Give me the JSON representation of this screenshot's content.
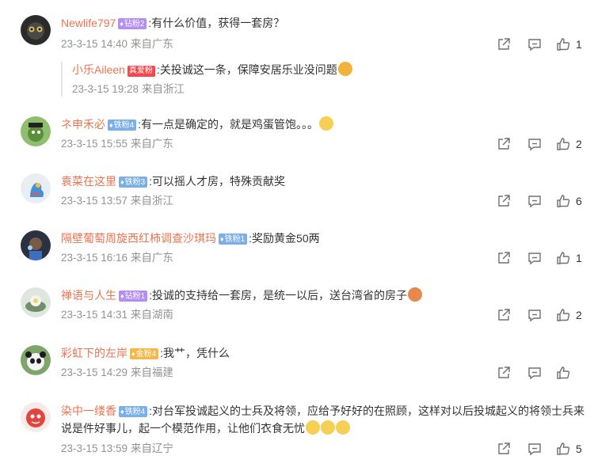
{
  "comments": [
    {
      "user": "Newlife797",
      "badge": "钻粉2",
      "text": ":有什么价值，获得一套房？",
      "time": "23-3-15 14:40",
      "loc": "来自广东",
      "likes": "1",
      "reply": {
        "user": "小乐Aileen",
        "badge": "真爱粉",
        "text": ":关投诚这一条，保障安居乐业没问题",
        "time": "23-3-15 19:28",
        "loc": "来自浙江"
      }
    },
    {
      "user": "ネ申禾必",
      "badge": "铁粉4",
      "text": ":有一点是确定的，就是鸡蛋管饱。。。",
      "time": "23-3-15 15:55",
      "loc": "来自广东",
      "likes": "2"
    },
    {
      "user": "袁菜在这里",
      "badge": "铁粉3",
      "text": ":可以摇人才房，特殊贡献奖",
      "time": "23-3-15 13:57",
      "loc": "来自浙江",
      "likes": "6"
    },
    {
      "user": "隔壁葡萄周旋西红柿调查沙琪玛",
      "badge": "铁粉1",
      "text": ":奖励黄金50两",
      "time": "23-3-15 16:16",
      "loc": "来自广东",
      "likes": "1"
    },
    {
      "user": "禅语与人生",
      "badge": "钻粉1",
      "text": ":投诚的支持给一套房，是统一以后，送台湾省的房子",
      "time": "23-3-15 14:31",
      "loc": "来自湖南",
      "likes": "2"
    },
    {
      "user": "彩虹下的左岸",
      "badge": "金粉4",
      "text": ":我艹，凭什么",
      "time": "23-3-15 14:29",
      "loc": "来自福建",
      "likes": ""
    },
    {
      "user": "染中一缕香",
      "badge": "铁粉4",
      "text": ":对台军投诚起义的士兵及将领，应给予好好的在照顾，这样对以后投城起义的将领士兵来说是件好事儿，起一个模范作用，让他们衣食无忧",
      "time": "23-3-15 13:59",
      "loc": "来自辽宁",
      "likes": "5"
    }
  ],
  "colors": {
    "username": "#eb7350",
    "meta": "#939393",
    "text": "#333333"
  },
  "icons": [
    "share-icon",
    "comment-icon",
    "like-icon"
  ]
}
